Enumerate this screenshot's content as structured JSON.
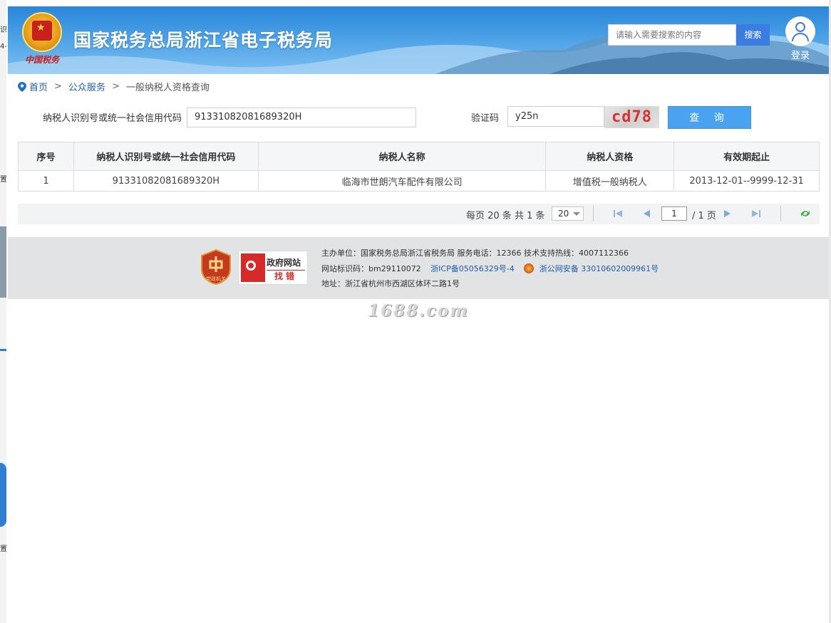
{
  "header": {
    "emblem_text": "中国税务",
    "title": "国家税务总局浙江省电子税务局",
    "search_placeholder": "请输入需要搜索的内容",
    "search_button": "搜索",
    "login_label": "登录"
  },
  "breadcrumb": {
    "home": "首页",
    "sep1": ">",
    "section": "公众服务",
    "sep2": ">",
    "current": "一般纳税人资格查询"
  },
  "form": {
    "id_label": "纳税人识别号或统一社会信用代码",
    "id_value": "91331082081689320H",
    "captcha_label": "验证码",
    "captcha_value": "y25n",
    "captcha_image_text": "cd78",
    "query_button": "查 询"
  },
  "table": {
    "headers": [
      "序号",
      "纳税人识别号或统一社会信用代码",
      "纳税人名称",
      "纳税人资格",
      "有效期起止"
    ],
    "rows": [
      [
        "1",
        "91331082081689320H",
        "临海市世朗汽车配件有限公司",
        "增值税一般纳税人",
        "2013-12-01--9999-12-31"
      ]
    ]
  },
  "pager": {
    "summary": "每页 20 条 共 1 条",
    "page_size": "20",
    "current_page": "1",
    "total_pages": "/ 1 页"
  },
  "footer": {
    "badge1_text": "党政机关",
    "badge2_title": "政府网站",
    "badge2_sub": "找错",
    "line1": "主办单位：国家税务总局浙江省税务局    服务电话：12366    技术支持热线：4007112366",
    "line2_prefix": "网站标识码：bm29110072",
    "icp": "浙ICP备05056329号-4",
    "police": "浙公网安备 33010602009961号",
    "line3": "地址：浙江省杭州市西湖区体环二路1号"
  },
  "watermark": "1688.com",
  "left_strip": {
    "t1": "识",
    "t2": "4-",
    "t3": "置",
    "t4": "置"
  },
  "colors": {
    "header_blue": "#2a86d9",
    "search_button": "#3a7ce0",
    "query_button": "#4aa3f0",
    "link": "#1f5fa8",
    "captcha_red": "#d8322f"
  }
}
